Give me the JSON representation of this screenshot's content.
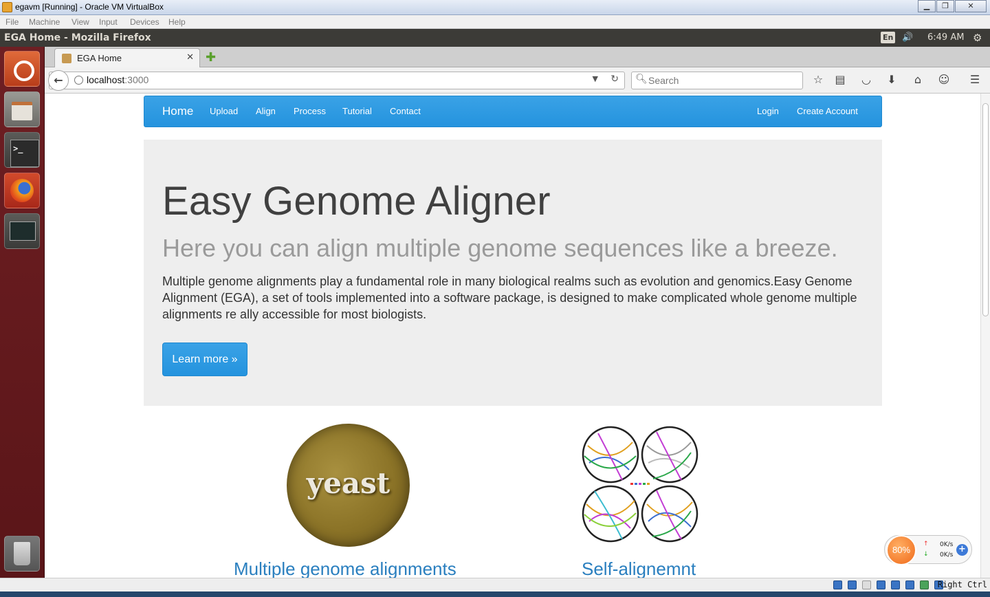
{
  "vbox": {
    "title": "egavm [Running] - Oracle VM VirtualBox",
    "menu": [
      "File",
      "Machine",
      "View",
      "Input",
      "Devices",
      "Help"
    ],
    "status_hostkey": "Right Ctrl"
  },
  "panel": {
    "window_title": "EGA Home - Mozilla Firefox",
    "keyboard": "En",
    "time": "6:49 AM"
  },
  "launcher": [
    "ubuntu-dash",
    "files",
    "terminal",
    "firefox",
    "system-monitor",
    "trash"
  ],
  "browser": {
    "tab_title": "EGA Home",
    "url_host": "localhost",
    "url_port": ":3000",
    "search_placeholder": "Search"
  },
  "site": {
    "nav": {
      "brand": "Home",
      "links": [
        "Upload",
        "Align",
        "Process",
        "Tutorial",
        "Contact"
      ],
      "right_links": [
        "Login",
        "Create Account"
      ]
    },
    "jumbotron": {
      "title": "Easy Genome Aligner",
      "subtitle": "Here you can align multiple genome sequences like a breeze.",
      "body": "Multiple genome alignments play a fundamental role in many biological realms such as evolution and genomics.Easy Genome Alignment (EGA), a set of tools implemented into a software package, is designed to make complicated whole genome multiple alignments re ally accessible for most biologists.",
      "button": "Learn more »"
    },
    "features": [
      {
        "image_text": "yeast",
        "caption": "Multiple genome alignments"
      },
      {
        "image_text": "",
        "caption": "Self-alignemnt"
      }
    ]
  },
  "speed_widget": {
    "percent": "80%",
    "up": "0K/s",
    "down": "0K/s"
  },
  "colors": {
    "nav_blue": "#2b9be3",
    "caption_blue": "#2a7fbf",
    "launcher_red": "#6e1f23"
  }
}
